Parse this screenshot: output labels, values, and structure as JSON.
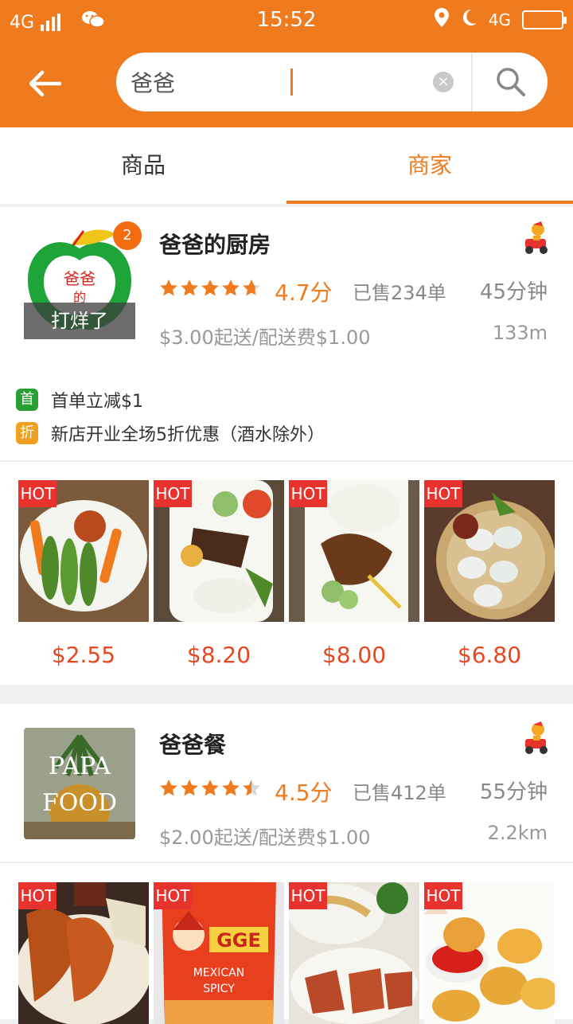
{
  "status": {
    "network": "4G",
    "time": "15:52",
    "network_right": "4G"
  },
  "search": {
    "value": "爸爸",
    "clear_symbol": "×"
  },
  "tabs": [
    {
      "label": "商品"
    },
    {
      "label": "商家"
    }
  ],
  "shops": [
    {
      "name": "爸爸的厨房",
      "badge": "2",
      "logo_overlay": "打烊了",
      "rating": 4.7,
      "score": "4.7分",
      "sold": "已售234单",
      "eta": "45分钟",
      "fee": "$3.00起送/配送费$1.00",
      "distance": "133m",
      "promos": [
        {
          "tag": "首",
          "text": "首单立减$1",
          "color": "#2aa034"
        },
        {
          "tag": "折",
          "text": "新店开业全场5折优惠（酒水除外）",
          "color": "#f0a020"
        }
      ],
      "foods": [
        {
          "hot": "HOT",
          "price": "$2.55"
        },
        {
          "hot": "HOT",
          "price": "$8.20"
        },
        {
          "hot": "HOT",
          "price": "$8.00"
        },
        {
          "hot": "HOT",
          "price": "$6.80"
        }
      ]
    },
    {
      "name": "爸爸餐",
      "logo_text_1": "PAPA",
      "logo_text_2": "FOOD",
      "rating": 4.5,
      "score": "4.5分",
      "sold": "已售412单",
      "eta": "55分钟",
      "fee": "$2.00起送/配送费$1.00",
      "distance": "2.2km",
      "foods": [
        {
          "hot": "HOT"
        },
        {
          "hot": "HOT",
          "label_1": "GGE",
          "label_2": "MEXICAN",
          "label_3": "SPICY"
        },
        {
          "hot": "HOT"
        },
        {
          "hot": "HOT"
        }
      ]
    }
  ],
  "colors": {
    "accent": "#f07a1e",
    "hot": "#e8322d",
    "price": "#e8461e"
  }
}
